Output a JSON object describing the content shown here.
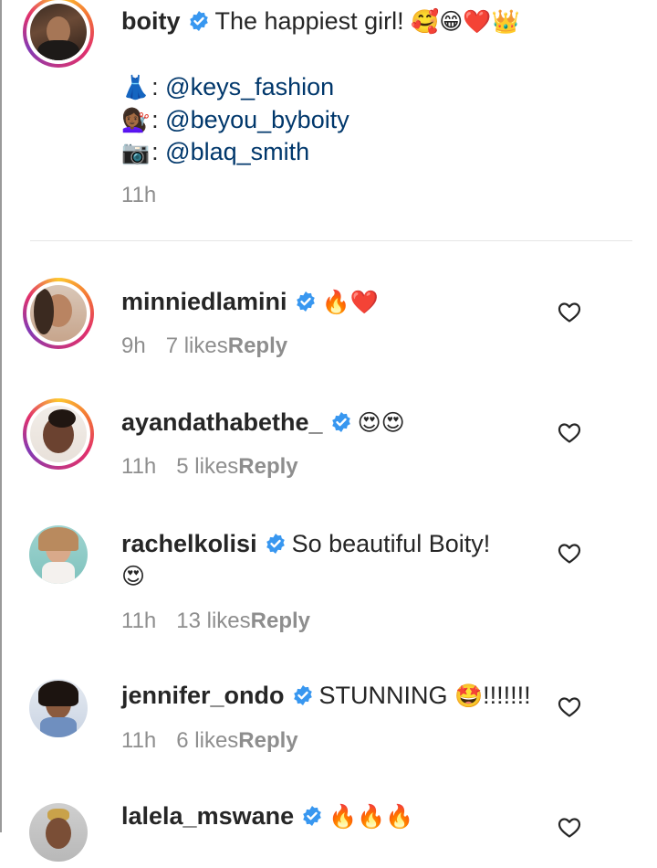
{
  "post": {
    "username": "boity",
    "caption": "The happiest girl!",
    "caption_emojis": "🥰😁❤️👑",
    "credits": [
      {
        "icon": "👗",
        "sep": ":",
        "handle": "@keys_fashion"
      },
      {
        "icon": "💇🏾‍♀️",
        "sep": ":",
        "handle": "@beyou_byboity"
      },
      {
        "icon": "📷",
        "sep": ":",
        "handle": "@blaq_smith"
      }
    ],
    "time": "11h"
  },
  "comments": [
    {
      "username": "minniedlamini",
      "text": "",
      "emoji": "🔥❤️",
      "time": "9h",
      "likes": "7 likes",
      "reply": "Reply"
    },
    {
      "username": "ayandathabethe_",
      "text": "",
      "emoji": "😍😍",
      "time": "11h",
      "likes": "5 likes",
      "reply": "Reply"
    },
    {
      "username": "rachelkolisi",
      "text": "So beautiful Boity!",
      "emoji": "😍",
      "time": "11h",
      "likes": "13 likes",
      "reply": "Reply"
    },
    {
      "username": "jennifer_ondo",
      "text": "STUNNING",
      "emoji": "🤩",
      "suffix": "!!!!!!!",
      "time": "11h",
      "likes": "6 likes",
      "reply": "Reply"
    },
    {
      "username": "lalela_mswane",
      "text": "",
      "emoji": "🔥🔥🔥"
    }
  ],
  "colors": {
    "verified_blue": "#3897f0",
    "link_blue": "#00376b",
    "meta_gray": "#8e8e8e"
  },
  "icons": {
    "verified": "verified-badge-icon",
    "like": "heart-outline-icon"
  }
}
